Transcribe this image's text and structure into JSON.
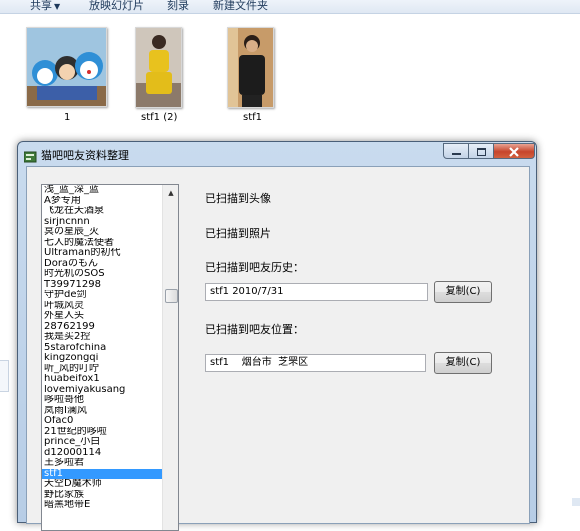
{
  "toolbar": {
    "items": [
      "共享",
      "放映幻灯片",
      "刻录",
      "新建文件夹"
    ]
  },
  "files": [
    {
      "name": "1"
    },
    {
      "name": "stf1 (2)"
    },
    {
      "name": "stf1"
    }
  ],
  "window": {
    "title": "猫吧吧友资料整理"
  },
  "list": {
    "items": [
      "浅_蓝_深_蓝",
      "A梦专用",
      "飞龙在天酒泉",
      "sirjncnnn",
      "冥の星辰_灭",
      "七人的魔法使者",
      "Ultraman的初代",
      "Doraのもん",
      "时光机のSOS",
      "T39971298",
      "守护de剑",
      "叶城风灵",
      "外星人头",
      "28762199",
      "我是买2控",
      "5starofchina",
      "kingzongqi",
      "听_风的叮咛",
      "huabeifox1",
      "lovemiyakusang",
      "哆啦哥他",
      "岚雨I澜风",
      "Ofac0",
      "21世纪的哆啦",
      "prince_小白",
      "d12000114",
      "王多啦君",
      "stf1",
      "天空D魔术师",
      "野比家族",
      "暗黑地带E"
    ],
    "selected_index": 27
  },
  "status": {
    "avatar": "已扫描到头像",
    "photo": "已扫描到照片"
  },
  "history": {
    "label": "已扫描到吧友历史：",
    "value": "stf1 2010/7/31",
    "copy_label": "复制(C)"
  },
  "location": {
    "label": "已扫描到吧友位置：",
    "value": "stf1    烟台市  芝罘区",
    "copy_label": "复制(C)"
  },
  "colors": {
    "selection": "#3399ff",
    "close_button": "#c7452c"
  }
}
